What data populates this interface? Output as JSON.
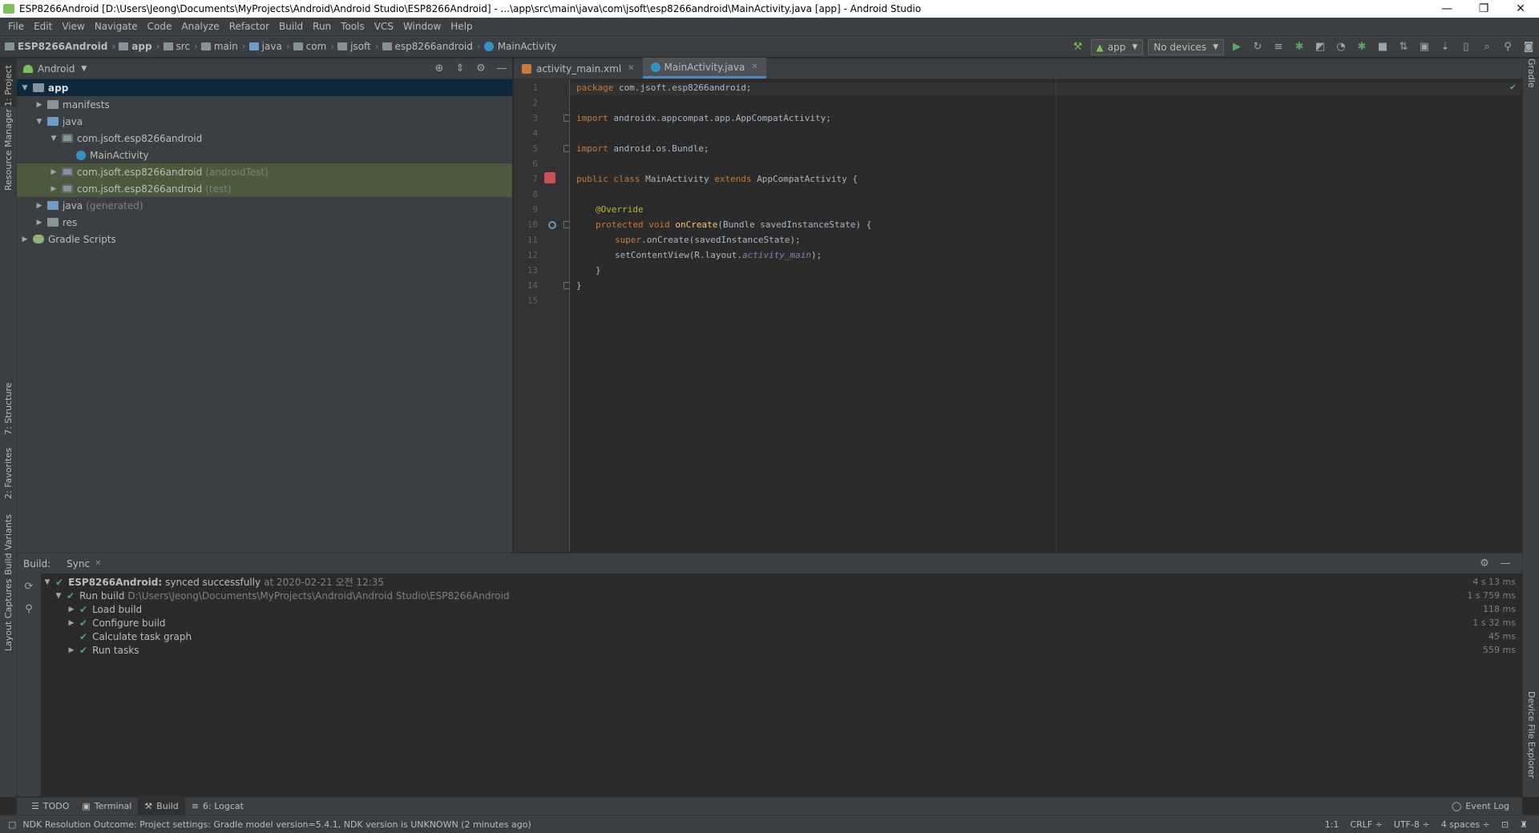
{
  "title_bar": {
    "text": "ESP8266Android [D:\\Users\\Jeong\\Documents\\MyProjects\\Android\\Android Studio\\ESP8266Android] - ...\\app\\src\\main\\java\\com\\jsoft\\esp8266android\\MainActivity.java [app] - Android Studio",
    "minimize": "—",
    "restore": "❐",
    "close": "✕"
  },
  "menu": [
    "File",
    "Edit",
    "View",
    "Navigate",
    "Code",
    "Analyze",
    "Refactor",
    "Build",
    "Run",
    "Tools",
    "VCS",
    "Window",
    "Help"
  ],
  "breadcrumb": [
    "ESP8266Android",
    "app",
    "src",
    "main",
    "java",
    "com",
    "jsoft",
    "esp8266android",
    "MainActivity"
  ],
  "toolbar": {
    "run_config": "app",
    "device": "No devices"
  },
  "left_strip": {
    "project": "1: Project",
    "resource_manager": "Resource Manager",
    "structure": "7: Structure",
    "favorites": "2: Favorites",
    "build_variants": "Build Variants",
    "layout_captures": "Layout Captures"
  },
  "right_strip": {
    "gradle": "Gradle",
    "device_file_explorer": "Device File Explorer"
  },
  "project_panel": {
    "view_mode": "Android",
    "tree": [
      {
        "label": "app",
        "suffix": ""
      },
      {
        "label": "manifests",
        "suffix": ""
      },
      {
        "label": "java",
        "suffix": ""
      },
      {
        "label": "com.jsoft.esp8266android",
        "suffix": ""
      },
      {
        "label": "MainActivity",
        "suffix": ""
      },
      {
        "label": "com.jsoft.esp8266android",
        "suffix": "(androidTest)"
      },
      {
        "label": "com.jsoft.esp8266android",
        "suffix": "(test)"
      },
      {
        "label": "java",
        "suffix": "(generated)"
      },
      {
        "label": "res",
        "suffix": ""
      },
      {
        "label": "Gradle Scripts",
        "suffix": ""
      }
    ]
  },
  "editor": {
    "tabs": [
      {
        "label": "activity_main.xml"
      },
      {
        "label": "MainActivity.java"
      }
    ],
    "line_numbers": [
      "1",
      "2",
      "3",
      "4",
      "5",
      "6",
      "7",
      "8",
      "9",
      "10",
      "11",
      "12",
      "13",
      "14",
      "15"
    ],
    "code": {
      "l1_kw": "package",
      "l1_rest": " com.jsoft.esp8266android;",
      "l3_kw": "import",
      "l3_rest": " androidx.appcompat.app.AppCompatActivity;",
      "l5_kw": "import",
      "l5_rest": " android.os.Bundle;",
      "l7_kw1": "public class",
      "l7_mid": " MainActivity ",
      "l7_kw2": "extends",
      "l7_rest": " AppCompatActivity {",
      "l9_an": "@Override",
      "l10_kw": "protected void",
      "l10_fn": " onCreate",
      "l10_rest": "(Bundle savedInstanceState) {",
      "l11_kw": "super",
      "l11_rest": ".onCreate(savedInstanceState);",
      "l12_a": "setContentView(R.layout.",
      "l12_f": "activity_main",
      "l12_b": ");",
      "l13": "}",
      "l14": "}"
    }
  },
  "build_panel": {
    "label": "Build:",
    "tab": "Sync",
    "rows": [
      {
        "name": "ESP8266Android:",
        "detail": "synced successfully",
        "extra": "at 2020-02-21 오전 12:35",
        "time": "4 s 13 ms"
      },
      {
        "name": "Run build",
        "detail": "",
        "extra": "D:\\Users\\Jeong\\Documents\\MyProjects\\Android\\Android Studio\\ESP8266Android",
        "time": "1 s 759 ms"
      },
      {
        "name": "Load build",
        "detail": "",
        "extra": "",
        "time": "118 ms"
      },
      {
        "name": "Configure build",
        "detail": "",
        "extra": "",
        "time": "1 s 32 ms"
      },
      {
        "name": "Calculate task graph",
        "detail": "",
        "extra": "",
        "time": "45 ms"
      },
      {
        "name": "Run tasks",
        "detail": "",
        "extra": "",
        "time": "559 ms"
      }
    ]
  },
  "bottom_tabs": {
    "todo": "TODO",
    "terminal": "Terminal",
    "build": "Build",
    "logcat": "6: Logcat",
    "event_log": "Event Log"
  },
  "status_bar": {
    "message": "NDK Resolution Outcome: Project settings: Gradle model version=5.4.1, NDK version is UNKNOWN (2 minutes ago)",
    "position": "1:1",
    "line_sep": "CRLF ÷",
    "encoding": "UTF-8 ÷",
    "indent": "4 spaces ÷"
  },
  "colors": {
    "accent": "#4a88c7",
    "success": "#59a869",
    "android_green": "#78c257"
  }
}
